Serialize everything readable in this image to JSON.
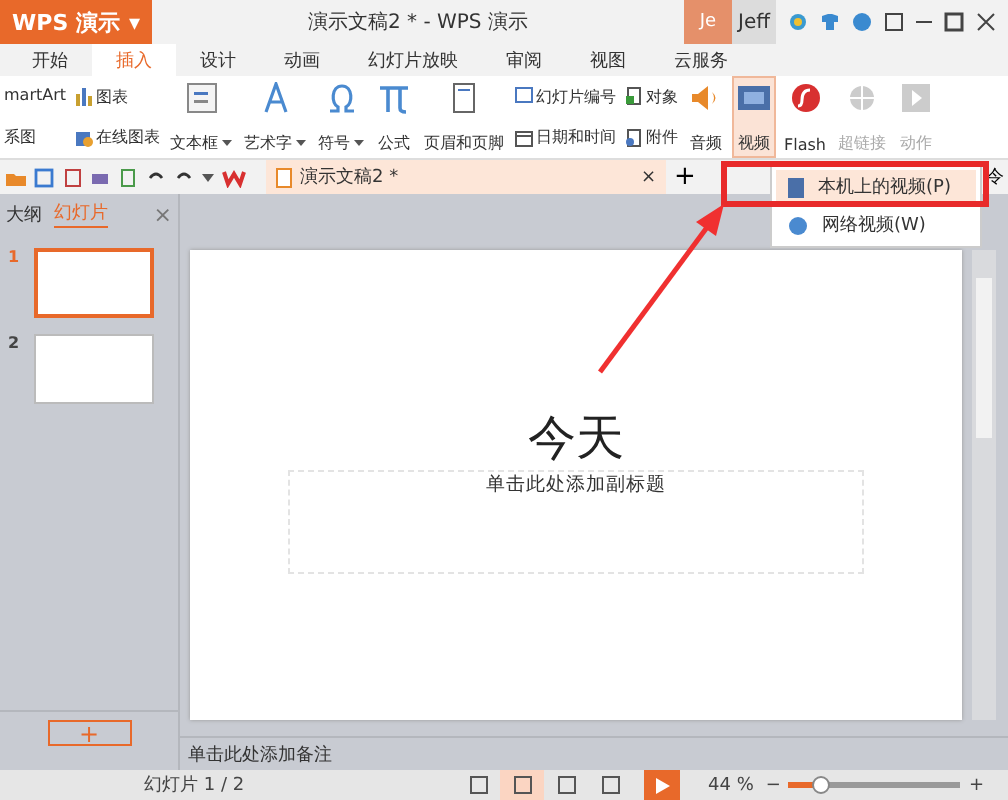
{
  "app_menu": {
    "label": "WPS 演示",
    "caret": "▾"
  },
  "window": {
    "title": "演示文稿2 * - WPS 演示",
    "user_badge": "Je",
    "user_name": "Jeff"
  },
  "tabs": [
    {
      "label": "开始",
      "selected": false
    },
    {
      "label": "插入",
      "selected": true
    },
    {
      "label": "设计",
      "selected": false
    },
    {
      "label": "动画",
      "selected": false
    },
    {
      "label": "幻灯片放映",
      "selected": false
    },
    {
      "label": "审阅",
      "selected": false
    },
    {
      "label": "视图",
      "selected": false
    },
    {
      "label": "云服务",
      "selected": false
    }
  ],
  "ribbon": [
    {
      "kind": "small",
      "items": [
        {
          "label": "martArt"
        },
        {
          "label": "系图"
        }
      ]
    },
    {
      "kind": "small",
      "items": [
        {
          "label": "图表"
        },
        {
          "label": "在线图表"
        }
      ]
    },
    {
      "kind": "large",
      "label": "文本框",
      "dropdown": true,
      "selected": false,
      "disabled": false
    },
    {
      "kind": "large",
      "label": "艺术字",
      "dropdown": true,
      "selected": false,
      "disabled": false
    },
    {
      "kind": "large",
      "label": "符号",
      "dropdown": true,
      "selected": false,
      "disabled": false
    },
    {
      "kind": "large",
      "label": "公式",
      "selected": false,
      "disabled": false
    },
    {
      "kind": "large",
      "label": "页眉和页脚",
      "selected": false,
      "disabled": false
    },
    {
      "kind": "small",
      "items": [
        {
          "label": "幻灯片编号"
        },
        {
          "label": "日期和时间"
        }
      ]
    },
    {
      "kind": "small",
      "items": [
        {
          "label": "对象"
        },
        {
          "label": "附件"
        }
      ]
    },
    {
      "kind": "large",
      "label": "音频",
      "selected": false,
      "disabled": false
    },
    {
      "kind": "large",
      "label": "视频",
      "selected": true,
      "disabled": false
    },
    {
      "kind": "large",
      "label": "Flash",
      "selected": false,
      "disabled": false
    },
    {
      "kind": "large",
      "label": "超链接",
      "selected": false,
      "disabled": true
    },
    {
      "kind": "large",
      "label": "动作",
      "selected": false,
      "disabled": true
    }
  ],
  "video_menu": [
    {
      "label": "本机上的视频(P)",
      "selected": true
    },
    {
      "label": "网络视频(W)",
      "selected": false
    }
  ],
  "doc_tab": {
    "label": "演示文稿2 *",
    "close": "×",
    "add": "+",
    "right_cut": "令"
  },
  "side_pane": {
    "tabs": [
      {
        "label": "大纲",
        "selected": false
      },
      {
        "label": "幻灯片",
        "selected": true
      }
    ],
    "close": "×",
    "thumbnails": [
      {
        "number": "1",
        "selected": true
      },
      {
        "number": "2",
        "selected": false
      }
    ],
    "add": "+"
  },
  "slide": {
    "title": "今天",
    "subtitle_placeholder": "单击此处添加副标题"
  },
  "notes_placeholder": "单击此处添加备注",
  "status_bar": {
    "slide_count": "幻灯片 1 / 2",
    "views": [
      {
        "selected": false
      },
      {
        "selected": true
      },
      {
        "selected": false
      },
      {
        "selected": false
      }
    ],
    "zoom": "44 %",
    "zoom_minus": "−",
    "zoom_plus": "+",
    "level": 0.18
  }
}
